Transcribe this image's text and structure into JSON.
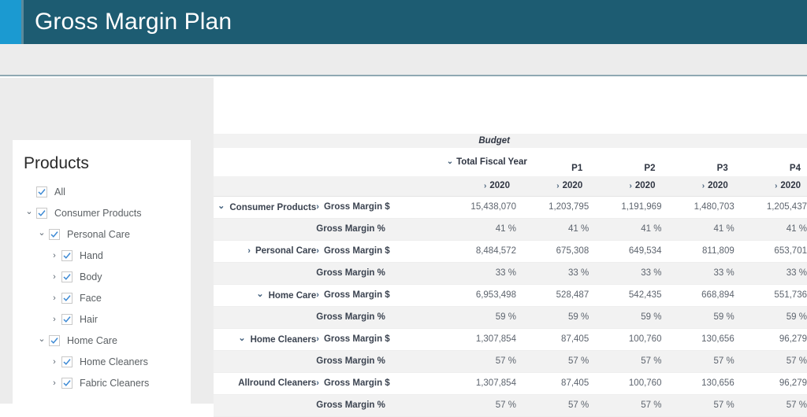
{
  "header": {
    "title": "Gross Margin Plan",
    "accent_color": "#1b9ad1",
    "bar_color": "#1d5c72"
  },
  "sidebar": {
    "title": "Products",
    "items": [
      {
        "label": "All",
        "indent": 0,
        "caret": "none",
        "checked": true
      },
      {
        "label": "Consumer Products",
        "indent": 0,
        "caret": "down",
        "checked": true
      },
      {
        "label": "Personal Care",
        "indent": 1,
        "caret": "down",
        "checked": true
      },
      {
        "label": "Hand",
        "indent": 2,
        "caret": "right",
        "checked": true
      },
      {
        "label": "Body",
        "indent": 2,
        "caret": "right",
        "checked": true
      },
      {
        "label": "Face",
        "indent": 2,
        "caret": "right",
        "checked": true
      },
      {
        "label": "Hair",
        "indent": 2,
        "caret": "right",
        "checked": true
      },
      {
        "label": "Home Care",
        "indent": 1,
        "caret": "down",
        "checked": true
      },
      {
        "label": "Home Cleaners",
        "indent": 2,
        "caret": "right",
        "checked": true
      },
      {
        "label": "Fabric Cleaners",
        "indent": 2,
        "caret": "right",
        "checked": true
      }
    ]
  },
  "table": {
    "scenario_label": "Budget",
    "periods": [
      {
        "name": "Total Fiscal Year",
        "caret": "down",
        "year": "2020"
      },
      {
        "name": "P1",
        "caret": "right",
        "year": "2020"
      },
      {
        "name": "P2",
        "caret": "right",
        "year": "2020"
      },
      {
        "name": "P3",
        "caret": "right",
        "year": "2020"
      },
      {
        "name": "P4",
        "caret": "right",
        "year": "2020"
      }
    ],
    "rows": [
      {
        "dimension": "Consumer Products",
        "dim_caret": "down",
        "dim_indent": 0,
        "measure": "Gross Margin $",
        "measure_caret": "right",
        "banding": "white",
        "values": [
          "15,438,070",
          "1,203,795",
          "1,191,969",
          "1,480,703",
          "1,205,437"
        ]
      },
      {
        "dimension": "",
        "dim_caret": "none",
        "dim_indent": 0,
        "measure": "Gross Margin %",
        "measure_caret": "none",
        "banding": "grey",
        "values": [
          "41 %",
          "41 %",
          "41 %",
          "41 %",
          "41 %"
        ]
      },
      {
        "dimension": "Personal Care",
        "dim_caret": "right",
        "dim_indent": 1,
        "measure": "Gross Margin $",
        "measure_caret": "right",
        "banding": "white",
        "values": [
          "8,484,572",
          "675,308",
          "649,534",
          "811,809",
          "653,701"
        ]
      },
      {
        "dimension": "",
        "dim_caret": "none",
        "dim_indent": 0,
        "measure": "Gross Margin %",
        "measure_caret": "none",
        "banding": "grey",
        "values": [
          "33 %",
          "33 %",
          "33 %",
          "33 %",
          "33 %"
        ]
      },
      {
        "dimension": "Home Care",
        "dim_caret": "down",
        "dim_indent": 1,
        "measure": "Gross Margin $",
        "measure_caret": "right",
        "banding": "white",
        "values": [
          "6,953,498",
          "528,487",
          "542,435",
          "668,894",
          "551,736"
        ]
      },
      {
        "dimension": "",
        "dim_caret": "none",
        "dim_indent": 0,
        "measure": "Gross Margin %",
        "measure_caret": "none",
        "banding": "grey",
        "values": [
          "59 %",
          "59 %",
          "59 %",
          "59 %",
          "59 %"
        ]
      },
      {
        "dimension": "Home Cleaners",
        "dim_caret": "down",
        "dim_indent": 2,
        "measure": "Gross Margin $",
        "measure_caret": "right",
        "banding": "white",
        "values": [
          "1,307,854",
          "87,405",
          "100,760",
          "130,656",
          "96,279"
        ]
      },
      {
        "dimension": "",
        "dim_caret": "none",
        "dim_indent": 0,
        "measure": "Gross Margin %",
        "measure_caret": "none",
        "banding": "grey",
        "values": [
          "57 %",
          "57 %",
          "57 %",
          "57 %",
          "57 %"
        ]
      },
      {
        "dimension": "Allround Cleaners",
        "dim_caret": "none",
        "dim_indent": 3,
        "measure": "Gross Margin $",
        "measure_caret": "right",
        "banding": "white",
        "values": [
          "1,307,854",
          "87,405",
          "100,760",
          "130,656",
          "96,279"
        ]
      },
      {
        "dimension": "",
        "dim_caret": "none",
        "dim_indent": 0,
        "measure": "Gross Margin %",
        "measure_caret": "none",
        "banding": "grey",
        "values": [
          "57 %",
          "57 %",
          "57 %",
          "57 %",
          "57 %"
        ]
      }
    ]
  }
}
